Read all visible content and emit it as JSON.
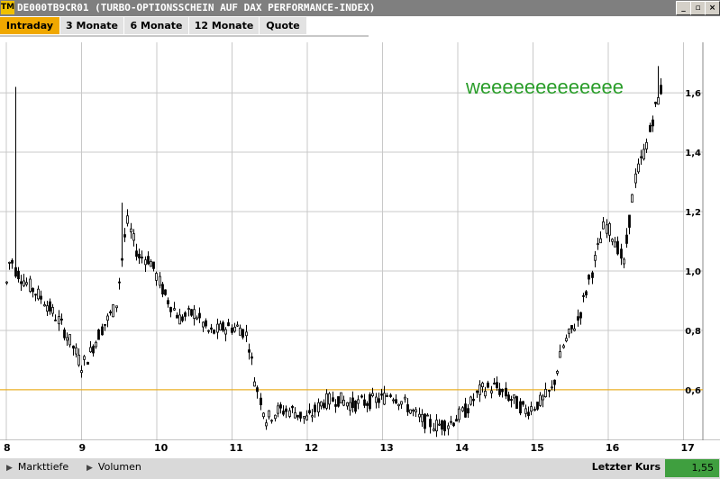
{
  "window": {
    "icon_text": "TM",
    "title": "DE000TB9CR01 (TURBO-OPTIONSSCHEIN AUF DAX PERFORMANCE-INDEX)",
    "controls": [
      "_",
      "▫",
      "×"
    ]
  },
  "tabs": [
    {
      "label": "Intraday",
      "active": true
    },
    {
      "label": "3 Monate",
      "active": false
    },
    {
      "label": "6 Monate",
      "active": false
    },
    {
      "label": "12 Monate",
      "active": false
    },
    {
      "label": "Quote",
      "active": false
    }
  ],
  "chart_data": {
    "type": "candlestick",
    "annotation": "weeeeeeeeeeeee",
    "x_ticks": [
      "8",
      "9",
      "10",
      "11",
      "12",
      "13",
      "14",
      "15",
      "16",
      "17"
    ],
    "y_ticks": [
      "0,6",
      "0,8",
      "1,0",
      "1,2",
      "1,4",
      "1,6"
    ],
    "xlim": [
      8,
      17.5
    ],
    "ylim": [
      0.43,
      1.77
    ],
    "reference_line": 0.6,
    "grid": true,
    "colors": {
      "candle": "#000000",
      "grid": "#c8c8c8",
      "reference": "#f0a800",
      "annotation": "#2a9d2a"
    },
    "waypoints": [
      [
        8.0,
        0.96
      ],
      [
        8.05,
        1.05
      ],
      [
        8.12,
        1.0
      ],
      [
        8.3,
        0.95
      ],
      [
        8.5,
        0.9
      ],
      [
        8.7,
        0.83
      ],
      [
        8.85,
        0.76
      ],
      [
        9.0,
        0.68
      ],
      [
        9.1,
        0.72
      ],
      [
        9.25,
        0.8
      ],
      [
        9.45,
        0.88
      ],
      [
        9.6,
        1.17
      ],
      [
        9.75,
        1.05
      ],
      [
        9.9,
        1.04
      ],
      [
        10.1,
        0.92
      ],
      [
        10.3,
        0.84
      ],
      [
        10.5,
        0.86
      ],
      [
        10.7,
        0.79
      ],
      [
        10.9,
        0.81
      ],
      [
        11.1,
        0.81
      ],
      [
        11.2,
        0.78
      ],
      [
        11.3,
        0.63
      ],
      [
        11.45,
        0.5
      ],
      [
        11.6,
        0.53
      ],
      [
        11.8,
        0.53
      ],
      [
        12.0,
        0.5
      ],
      [
        12.2,
        0.56
      ],
      [
        12.4,
        0.57
      ],
      [
        12.6,
        0.55
      ],
      [
        12.8,
        0.56
      ],
      [
        13.0,
        0.57
      ],
      [
        13.1,
        0.59
      ],
      [
        13.3,
        0.55
      ],
      [
        13.5,
        0.5
      ],
      [
        13.7,
        0.48
      ],
      [
        13.9,
        0.49
      ],
      [
        14.1,
        0.53
      ],
      [
        14.3,
        0.6
      ],
      [
        14.5,
        0.61
      ],
      [
        14.7,
        0.57
      ],
      [
        14.9,
        0.53
      ],
      [
        15.1,
        0.56
      ],
      [
        15.25,
        0.6
      ],
      [
        15.4,
        0.75
      ],
      [
        15.6,
        0.84
      ],
      [
        15.8,
        1.02
      ],
      [
        15.95,
        1.16
      ],
      [
        16.1,
        1.1
      ],
      [
        16.2,
        1.02
      ],
      [
        16.35,
        1.31
      ],
      [
        16.5,
        1.42
      ],
      [
        16.6,
        1.53
      ],
      [
        16.7,
        1.61
      ],
      [
        16.72,
        1.55
      ]
    ],
    "spikes": [
      [
        8.1,
        1.62
      ],
      [
        9.55,
        1.23
      ],
      [
        16.67,
        1.69
      ]
    ]
  },
  "bottombar": {
    "markttiefe": "Markttiefe",
    "volumen": "Volumen",
    "letzter_kurs_label": "Letzter Kurs",
    "letzter_kurs_value": "1,55"
  }
}
